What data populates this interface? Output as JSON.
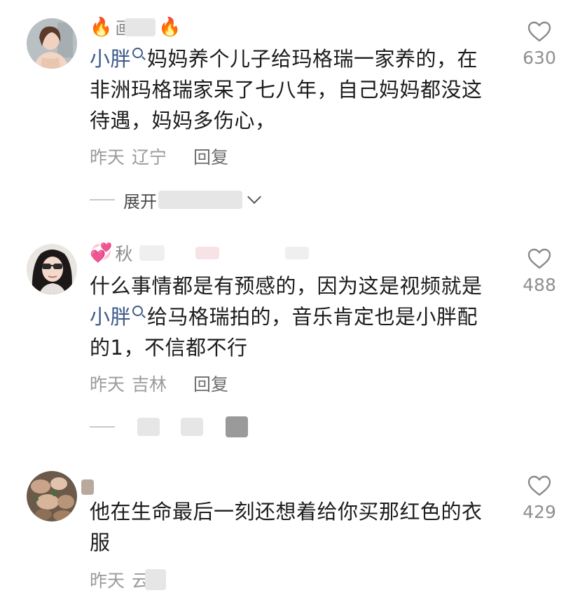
{
  "comments": [
    {
      "name_emoji_left": "🔥",
      "name_visible": "画颜",
      "name_emoji_right": "🔥",
      "mention": "小胖",
      "text_after_mention": "妈妈养个儿子给玛格瑞一家养的，在非洲玛格瑞家呆了七八年，自己妈妈都没这待遇，妈妈多伤心，",
      "time": "昨天",
      "region": "辽宁",
      "reply_label": "回复",
      "expand_label": "展开",
      "likes": "630"
    },
    {
      "name_emoji_left": "💞",
      "name_visible": "秋",
      "line1": "什么事情都是有预感的，因为这是视频就是",
      "mention": "小胖",
      "text_after_mention": "给马格瑞拍的，音乐肯定也是小胖配的1，不信都不行",
      "time": "昨天",
      "region": "吉林",
      "reply_label": "回复",
      "likes": "488"
    },
    {
      "text": "他在生命最后一刻还想着给你买那红色的衣服",
      "time": "昨天",
      "region_partial": "云",
      "likes": "429"
    }
  ],
  "colors": {
    "mention": "#3d5a88",
    "meta": "#9b9b9b",
    "text": "#1c1c1c"
  },
  "icons": {
    "like": "heart-outline-icon",
    "mention": "search-icon",
    "expand": "chevron-down-icon"
  }
}
